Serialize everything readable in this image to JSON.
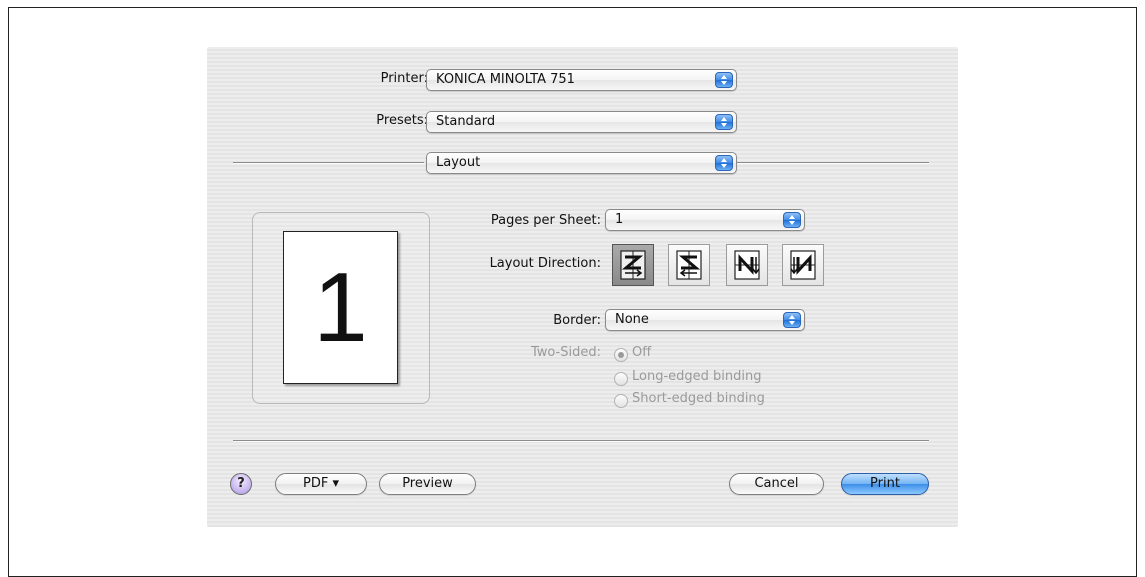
{
  "printer": {
    "label": "Printer:",
    "value": "KONICA MINOLTA 751"
  },
  "presets": {
    "label": "Presets:",
    "value": "Standard"
  },
  "panel_menu": {
    "value": "Layout"
  },
  "preview": {
    "page_number": "1"
  },
  "pages_per_sheet": {
    "label": "Pages per Sheet:",
    "value": "1"
  },
  "layout_direction": {
    "label": "Layout Direction:",
    "options": [
      "z-left-to-right",
      "z-right-to-left",
      "n-top-to-bottom-left",
      "n-top-to-bottom-right"
    ],
    "selected_index": 0
  },
  "border": {
    "label": "Border:",
    "value": "None"
  },
  "two_sided": {
    "label": "Two-Sided:",
    "options": [
      "Off",
      "Long-edged binding",
      "Short-edged binding"
    ],
    "selected": "Off",
    "enabled": false
  },
  "buttons": {
    "help": "?",
    "pdf": "PDF ▾",
    "preview": "Preview",
    "cancel": "Cancel",
    "print": "Print"
  },
  "colors": {
    "accent_blue": "#3e8ee8",
    "dialog_bg": "#eaeaea"
  }
}
